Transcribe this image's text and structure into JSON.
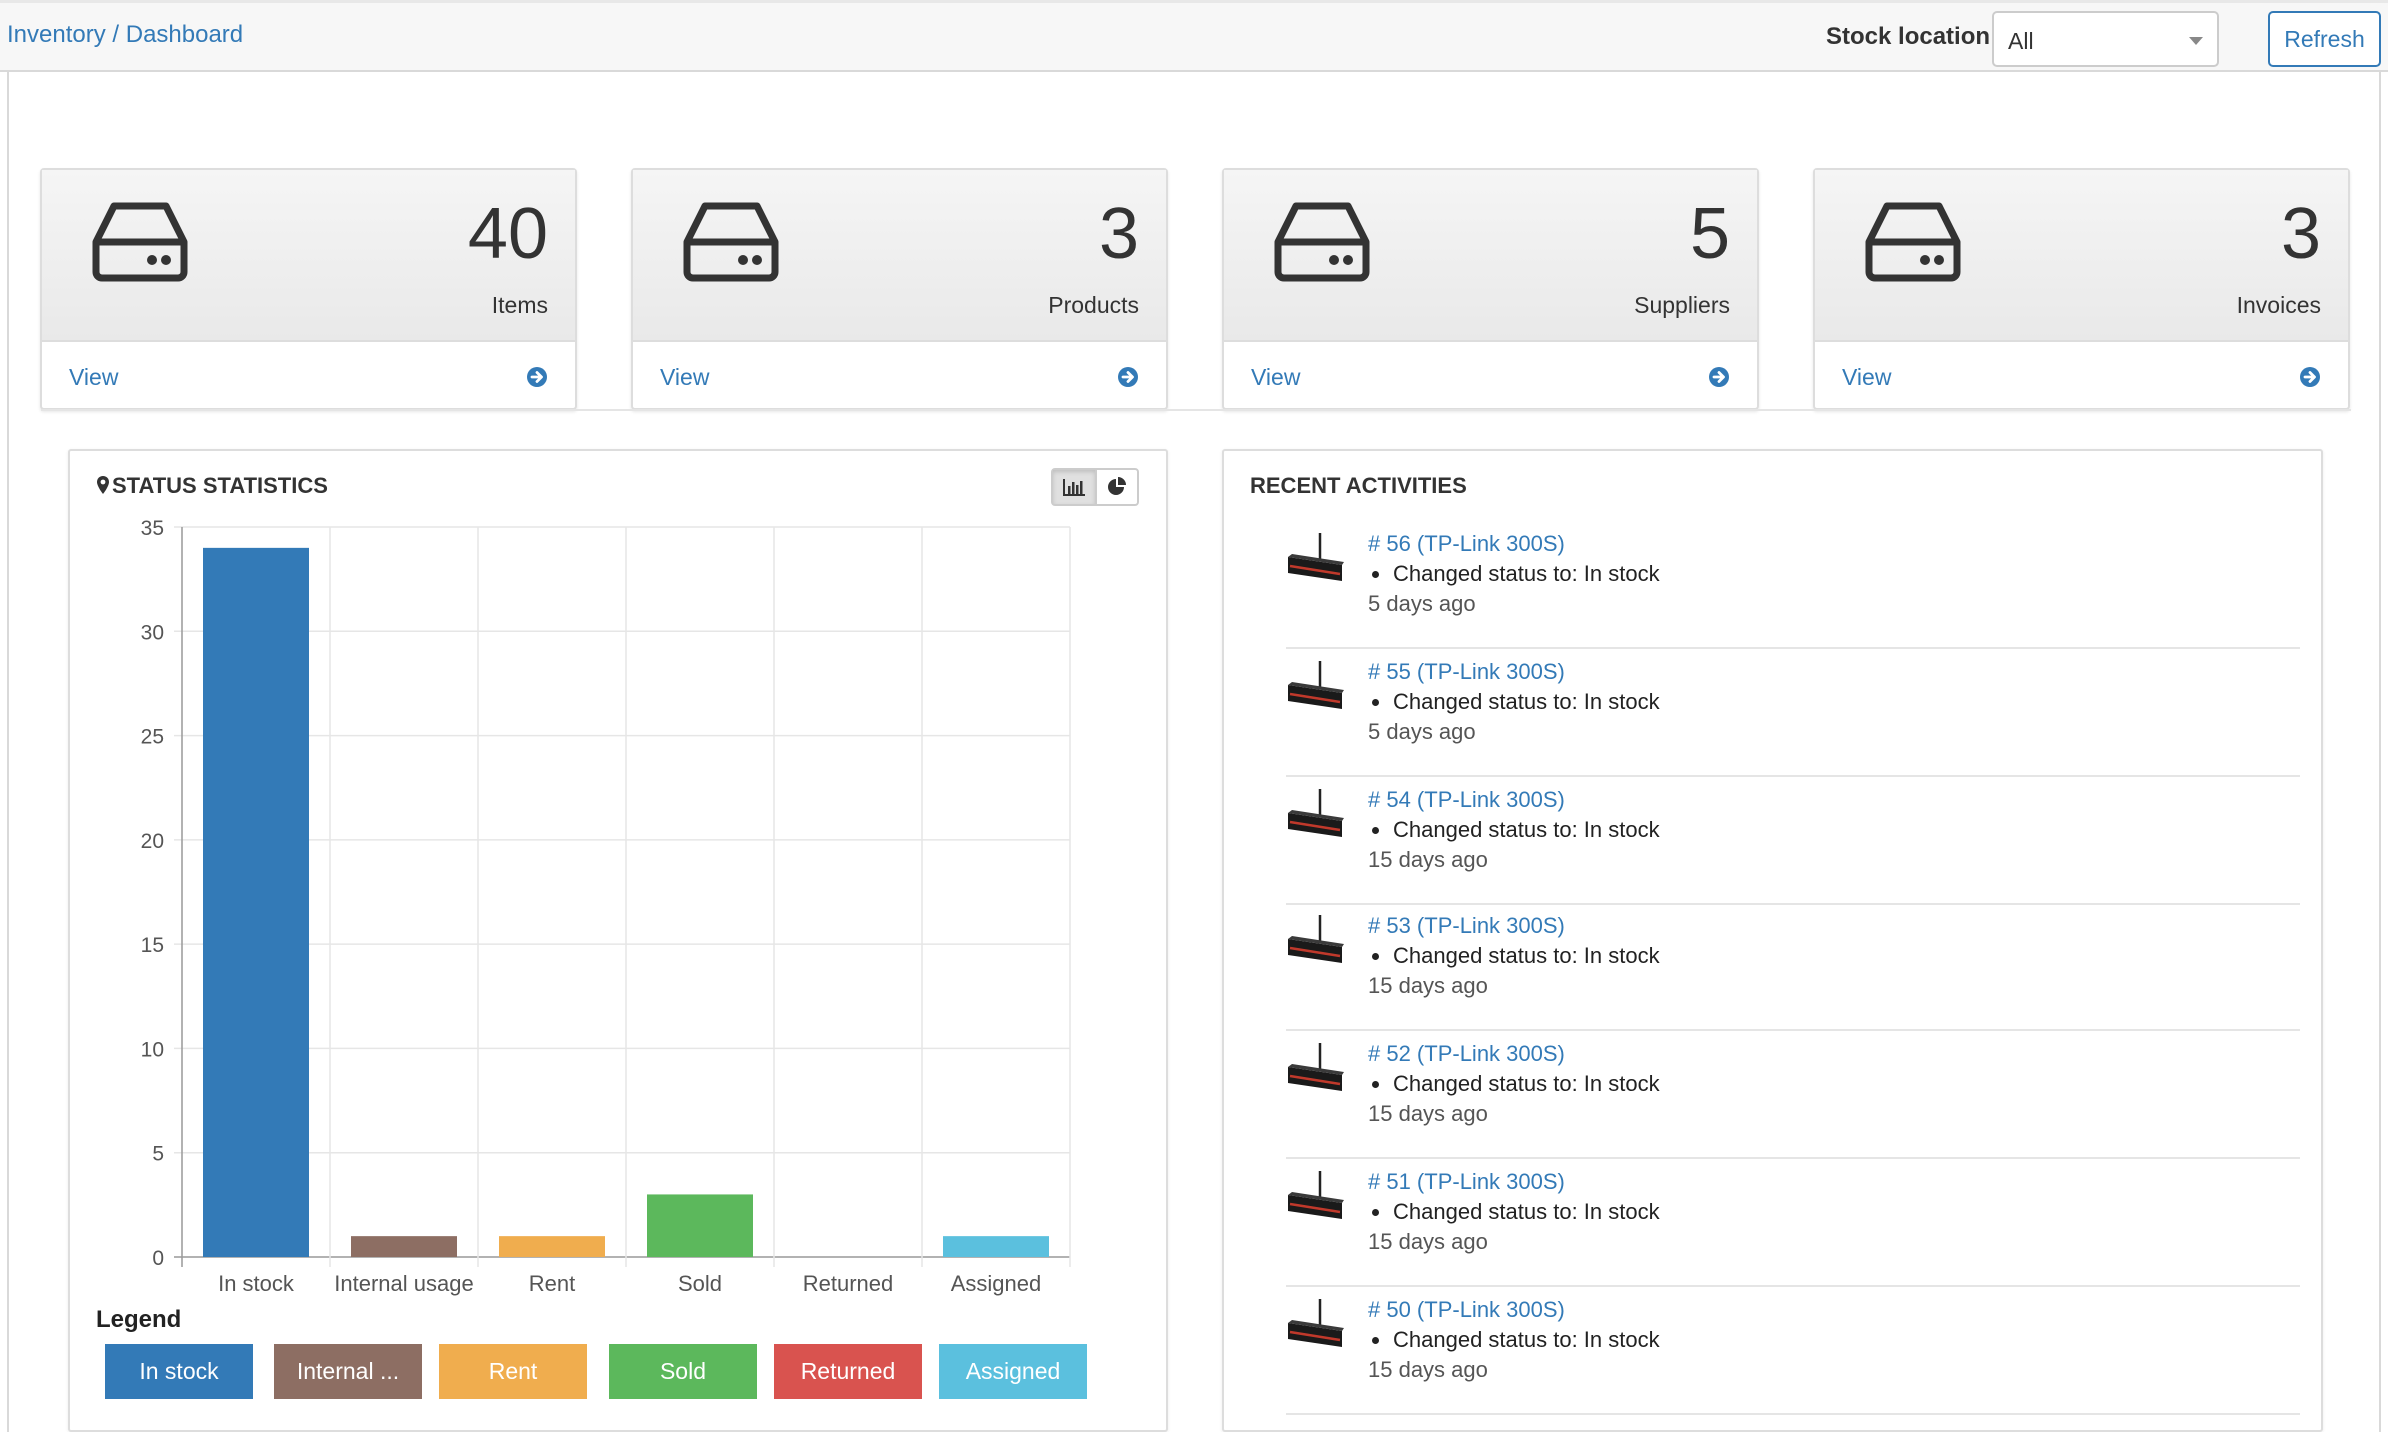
{
  "breadcrumb": {
    "root": "Inventory",
    "separator": "/",
    "current": "Dashboard"
  },
  "toolbar": {
    "stock_location_label": "Stock location",
    "stock_location_value": "All",
    "refresh_label": "Refresh"
  },
  "cards": [
    {
      "value": "40",
      "label": "Items",
      "link": "View",
      "icon": "hard-drive-icon"
    },
    {
      "value": "3",
      "label": "Products",
      "link": "View",
      "icon": "hard-drive-icon"
    },
    {
      "value": "5",
      "label": "Suppliers",
      "link": "View",
      "icon": "hard-drive-icon"
    },
    {
      "value": "3",
      "label": "Invoices",
      "link": "View",
      "icon": "hard-drive-icon"
    }
  ],
  "status_panel": {
    "title": "STATUS STATISTICS",
    "legend_title": "Legend",
    "icon": "map-marker-icon",
    "toggle_icons": [
      "bar-chart-icon",
      "pie-chart-icon"
    ]
  },
  "chart_data": {
    "type": "bar",
    "categories": [
      "In stock",
      "Internal usage",
      "Rent",
      "Sold",
      "Returned",
      "Assigned"
    ],
    "values": [
      34,
      1,
      1,
      3,
      0,
      1
    ],
    "colors": [
      "#337ab7",
      "#8d6e63",
      "#f0ad4e",
      "#5cb85c",
      "#d9534f",
      "#5bc0de"
    ],
    "ylim": [
      0,
      35
    ],
    "yticks": [
      0,
      5,
      10,
      15,
      20,
      25,
      30,
      35
    ],
    "grid": true,
    "legend": [
      "In stock",
      "Internal ...",
      "Rent",
      "Sold",
      "Returned",
      "Assigned"
    ],
    "legend_position": "bottom"
  },
  "activities_panel": {
    "title": "RECENT ACTIVITIES",
    "items": [
      {
        "link": "# 56 (TP-Link 300S)",
        "detail": "Changed status to: In stock",
        "time": "5 days ago"
      },
      {
        "link": "# 55 (TP-Link 300S)",
        "detail": "Changed status to: In stock",
        "time": "5 days ago"
      },
      {
        "link": "# 54 (TP-Link 300S)",
        "detail": "Changed status to: In stock",
        "time": "15 days ago"
      },
      {
        "link": "# 53 (TP-Link 300S)",
        "detail": "Changed status to: In stock",
        "time": "15 days ago"
      },
      {
        "link": "# 52 (TP-Link 300S)",
        "detail": "Changed status to: In stock",
        "time": "15 days ago"
      },
      {
        "link": "# 51 (TP-Link 300S)",
        "detail": "Changed status to: In stock",
        "time": "15 days ago"
      },
      {
        "link": "# 50 (TP-Link 300S)",
        "detail": "Changed status to: In stock",
        "time": "15 days ago"
      }
    ]
  },
  "colors": {
    "link": "#337ab7",
    "card_bg": "#efefef",
    "border": "#dddddd"
  }
}
